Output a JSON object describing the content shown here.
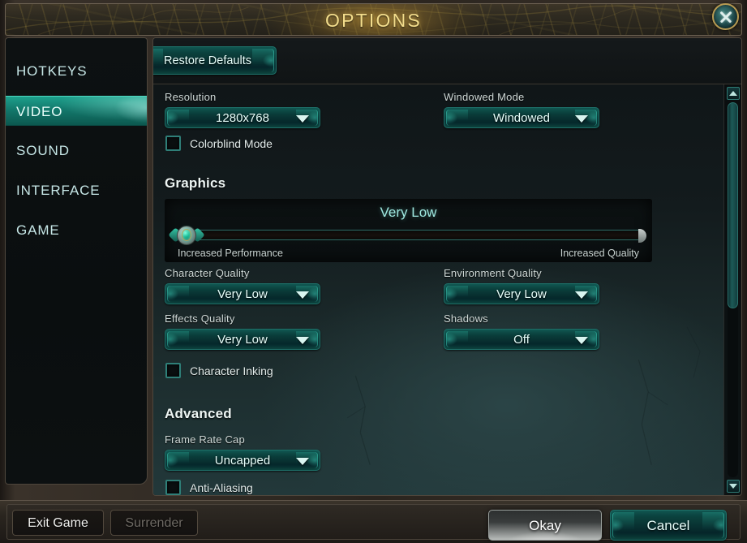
{
  "window": {
    "title": "OPTIONS",
    "close_icon": "close-x-icon"
  },
  "sidebar": {
    "items": [
      {
        "label": "HOTKEYS",
        "active": false
      },
      {
        "label": "VIDEO",
        "active": true
      },
      {
        "label": "SOUND",
        "active": false
      },
      {
        "label": "INTERFACE",
        "active": false
      },
      {
        "label": "GAME",
        "active": false
      }
    ]
  },
  "main": {
    "title": "Video",
    "restore_defaults_label": "Restore Defaults",
    "resolution": {
      "label": "Resolution",
      "value": "1280x768",
      "caret_icon": "chevron-down-icon"
    },
    "windowed_mode": {
      "label": "Windowed Mode",
      "value": "Windowed",
      "caret_icon": "chevron-down-icon"
    },
    "colorblind_mode": {
      "label": "Colorblind Mode",
      "checked": false
    },
    "graphics_section": {
      "heading": "Graphics",
      "slider_value": "Very Low",
      "slider_min_label": "Increased Performance",
      "slider_max_label": "Increased Quality",
      "slider_position_pct": 0
    },
    "character_quality": {
      "label": "Character Quality",
      "value": "Very Low",
      "caret_icon": "chevron-down-icon"
    },
    "environment_quality": {
      "label": "Environment Quality",
      "value": "Very Low",
      "caret_icon": "chevron-down-icon"
    },
    "effects_quality": {
      "label": "Effects Quality",
      "value": "Very Low",
      "caret_icon": "chevron-down-icon"
    },
    "shadows": {
      "label": "Shadows",
      "value": "Off",
      "caret_icon": "chevron-down-icon"
    },
    "character_inking": {
      "label": "Character Inking",
      "checked": false
    },
    "advanced_section": {
      "heading": "Advanced"
    },
    "frame_rate_cap": {
      "label": "Frame Rate Cap",
      "value": "Uncapped",
      "caret_icon": "chevron-down-icon"
    },
    "anti_aliasing": {
      "label": "Anti-Aliasing",
      "checked": false
    }
  },
  "scrollbar": {
    "up_icon": "triangle-up-icon",
    "down_icon": "triangle-down-icon",
    "thumb_pct": 55
  },
  "footer": {
    "exit_game_label": "Exit Game",
    "surrender_label": "Surrender",
    "surrender_disabled": true,
    "okay_label": "Okay",
    "cancel_label": "Cancel"
  },
  "colors": {
    "accent_teal": "#18a08c",
    "title_gold": "#f3dd8c",
    "heading_text": "#b4ece8",
    "panel_bg": "#1b2a2b",
    "frame_bronze": "#6d6253"
  }
}
